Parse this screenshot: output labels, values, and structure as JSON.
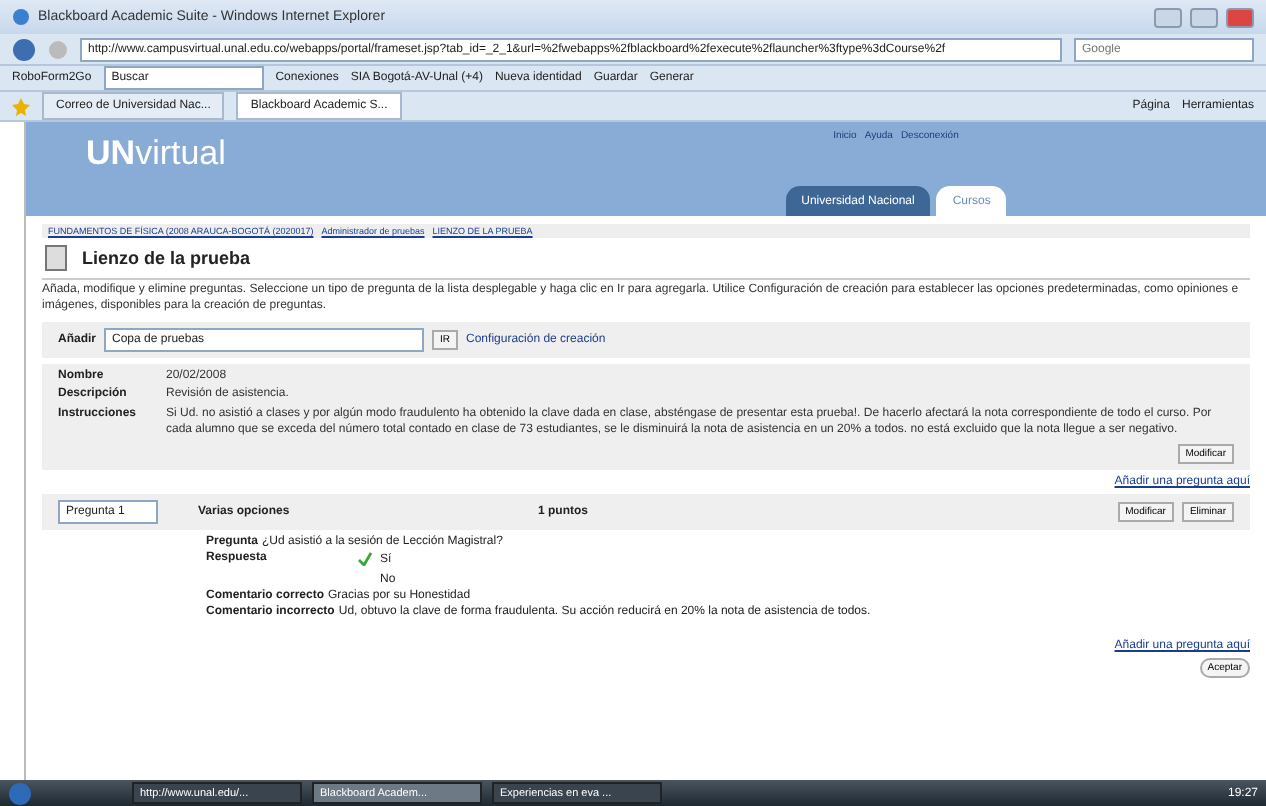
{
  "window": {
    "title": "Blackboard Academic Suite - Windows Internet Explorer"
  },
  "address_bar": {
    "url": "http://www.campusvirtual.unal.edu.co/webapps/portal/frameset.jsp?tab_id=_2_1&url=%2fwebapps%2fblackboard%2fexecute%2flauncher%3ftype%3dCourse%2f",
    "search_placeholder": "Google"
  },
  "links_bar": {
    "items": [
      "RoboForm2Go",
      "Conexiones",
      "SIA Bogotá-AV-Unal (+4)",
      "Nueva identidad",
      "Guardar",
      "Generar"
    ],
    "search_label": "Buscar"
  },
  "browser_tabs": [
    {
      "label": "Correo de Universidad Nac...",
      "selected": false
    },
    {
      "label": "Blackboard Academic S...",
      "selected": true
    }
  ],
  "command_bar": [
    "Página",
    "Herramientas"
  ],
  "site": {
    "logo_prefix": "UN",
    "logo_suffix": "virtual",
    "top_links": [
      "Inicio",
      "Ayuda",
      "Desconexión"
    ],
    "tabs": [
      {
        "label": "Universidad Nacional",
        "selected": false
      },
      {
        "label": "Cursos",
        "selected": true
      }
    ]
  },
  "breadcrumb": [
    "FUNDAMENTOS DE FÍSICA (2008 ARAUCA-BOGOTÁ (2020017)",
    "Administrador de pruebas",
    "LIENZO DE LA PRUEBA"
  ],
  "page_title": "Lienzo de la prueba",
  "intro": "Añada, modifique y elimine preguntas. Seleccione un tipo de pregunta de la lista desplegable y haga clic en Ir para agregarla. Utilice Configuración de creación para establecer las opciones predeterminadas, como opiniones e imágenes, disponibles para la creación de preguntas.",
  "add_bar": {
    "label": "Añadir",
    "select_value": "Copa de pruebas",
    "go": "IR",
    "settings_link": "Configuración de creación"
  },
  "info": [
    {
      "label": "Nombre",
      "value": "20/02/2008"
    },
    {
      "label": "Descripción",
      "value": "Revisión de asistencia."
    },
    {
      "label": "Instrucciones",
      "value": "Si Ud. no asistió a clases y por algún modo fraudulento ha obtenido la clave dada en clase, absténgase de presentar esta prueba!. De hacerlo afectará la nota correspondiente de todo el curso. Por cada alumno que se exceda del número total contado en clase de 73 estudiantes, se le disminuirá la nota de asistencia en un 20% a todos. no está excluido que la nota llegue a ser negativo."
    }
  ],
  "modify_button": "Modificar",
  "add_question_links": [
    "Añadir una pregunta aquí",
    "Añadir una pregunta aquí"
  ],
  "question": {
    "number": "Pregunta 1",
    "type": "Varias opciones",
    "points": "1 puntos",
    "buttons": [
      "Modificar",
      "Eliminar"
    ],
    "question_label": "Pregunta",
    "question_text": "¿Ud asistió a la sesión de Lección Magistral?",
    "answer_label": "Respuesta",
    "answers": [
      {
        "text": "Sí",
        "correct": true
      },
      {
        "text": "No",
        "correct": false
      }
    ],
    "feedback": [
      {
        "label": "Comentario correcto",
        "text": "Gracias por su Honestidad"
      },
      {
        "label": "Comentario incorrecto",
        "text": "Ud, obtuvo la clave de forma fraudulenta. Su acción reducirá en 20% la nota de asistencia de todos."
      }
    ]
  },
  "submit_button": "Aceptar",
  "taskbar": {
    "windows": [
      {
        "label": "http://www.unal.edu/...",
        "selected": false
      },
      {
        "label": "Blackboard Academ...",
        "selected": true
      },
      {
        "label": "Experiencias en eva ...",
        "selected": false
      }
    ],
    "clock": "19:27"
  }
}
